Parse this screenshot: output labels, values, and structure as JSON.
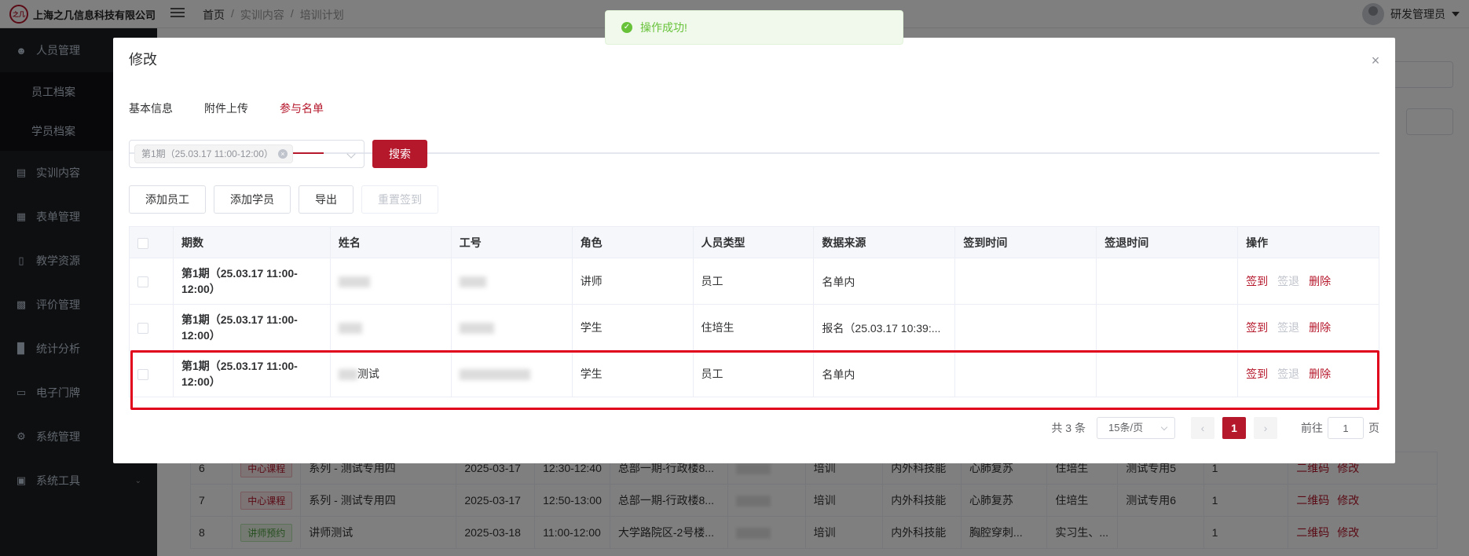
{
  "app": {
    "company_name": "上海之几信息科技有限公司",
    "logo_mark": "之几"
  },
  "breadcrumb": [
    "首页",
    "实训内容",
    "培训计划"
  ],
  "user": {
    "name": "研发管理员"
  },
  "sidebar": {
    "items": [
      {
        "label": "人员管理",
        "icon": "user-icon"
      },
      {
        "label": "员工档案",
        "sub": true
      },
      {
        "label": "学员档案",
        "sub": true
      },
      {
        "label": "实训内容",
        "icon": "book-icon"
      },
      {
        "label": "表单管理",
        "icon": "form-icon"
      },
      {
        "label": "教学资源",
        "icon": "resource-icon"
      },
      {
        "label": "评价管理",
        "icon": "evaluate-icon"
      },
      {
        "label": "统计分析",
        "icon": "chart-icon"
      },
      {
        "label": "电子门牌",
        "icon": "monitor-icon"
      },
      {
        "label": "系统管理",
        "icon": "gear-icon"
      },
      {
        "label": "系统工具",
        "icon": "toolbox-icon"
      }
    ]
  },
  "background_table": {
    "rows": [
      {
        "no": "6",
        "tag": "中心课程",
        "name": "系列 - 测试专用四",
        "date": "2025-03-17",
        "time": "12:30-12:40",
        "place": "总部一期-行政楼8...",
        "type": "培训",
        "dept": "内外科技能",
        "course": "心肺复苏",
        "target": "住培生",
        "remark": "测试专用5",
        "count": "1",
        "op1": "二维码",
        "op2": "修改"
      },
      {
        "no": "7",
        "tag": "中心课程",
        "name": "系列 - 测试专用四",
        "date": "2025-03-17",
        "time": "12:50-13:00",
        "place": "总部一期-行政楼8...",
        "type": "培训",
        "dept": "内外科技能",
        "course": "心肺复苏",
        "target": "住培生",
        "remark": "测试专用6",
        "count": "1",
        "op1": "二维码",
        "op2": "修改"
      },
      {
        "no": "8",
        "tag": "讲师预约",
        "name": "讲师测试",
        "date": "2025-03-18",
        "time": "11:00-12:00",
        "place": "大学路院区-2号楼...",
        "type": "培训",
        "dept": "内外科技能",
        "course": "胸腔穿刺...",
        "target": "实习生、...",
        "remark": "",
        "count": "1",
        "op1": "二维码",
        "op2": "修改"
      }
    ]
  },
  "toast": {
    "message": "操作成功!"
  },
  "modal": {
    "title": "修改",
    "tabs": [
      "基本信息",
      "附件上传",
      "参与名单"
    ],
    "active_tab": 2,
    "select_chip": "第1期（25.03.17 11:00-12:00）",
    "search_label": "搜索",
    "actions": [
      "添加员工",
      "添加学员",
      "导出",
      "重置签到"
    ],
    "columns": [
      "期数",
      "姓名",
      "工号",
      "角色",
      "人员类型",
      "数据来源",
      "签到时间",
      "签退时间",
      "操作"
    ],
    "rows": [
      {
        "period": "第1期（25.03.17 11:00-12:00）",
        "name_suffix": "",
        "role": "讲师",
        "person_type": "员工",
        "source": "名单内",
        "sign_in": "",
        "sign_out": ""
      },
      {
        "period": "第1期（25.03.17 11:00-12:00）",
        "name_suffix": "",
        "role": "学生",
        "person_type": "住培生",
        "source": "报名（25.03.17 10:39:...",
        "sign_in": "",
        "sign_out": ""
      },
      {
        "period": "第1期（25.03.17 11:00-12:00）",
        "name_suffix": "测试",
        "role": "学生",
        "person_type": "员工",
        "source": "名单内",
        "sign_in": "",
        "sign_out": ""
      }
    ],
    "row_ops": [
      "签到",
      "签退",
      "删除"
    ],
    "pagination": {
      "total": "共 3 条",
      "page_size": "15条/页",
      "current": "1",
      "goto_label": "前往",
      "goto_value": "1",
      "page_unit": "页"
    }
  },
  "colors": {
    "accent": "#b5172b",
    "highlight": "#e0001b",
    "success": "#67c23a"
  }
}
